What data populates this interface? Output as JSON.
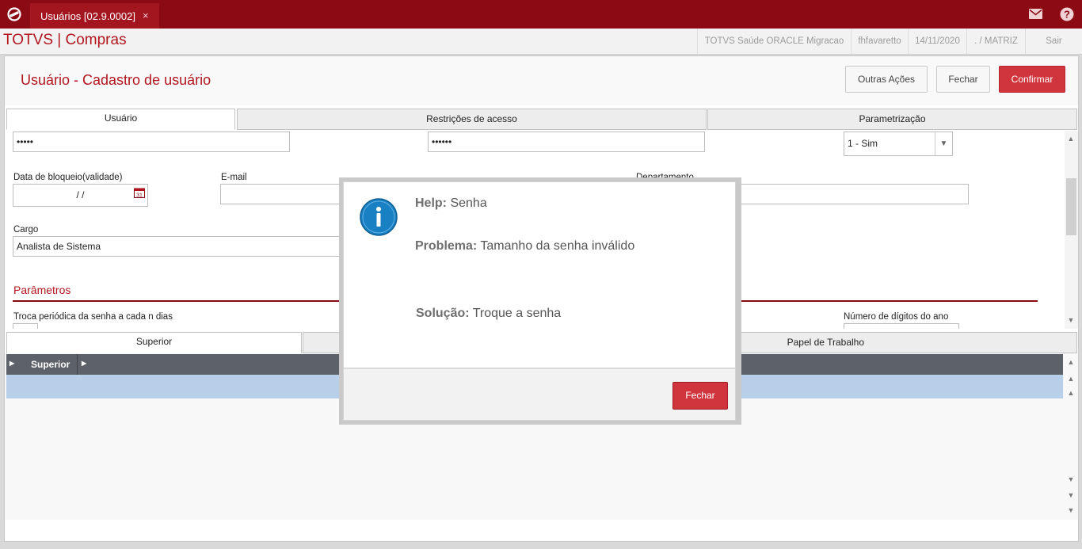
{
  "topbar": {
    "tab_label": "Usuários [02.9.0002]",
    "tab_close": "×"
  },
  "appbar": {
    "title": "TOTVS | Compras",
    "environment": "TOTVS Saúde ORACLE Migracao",
    "user": "fhfavaretto",
    "date": "14/11/2020",
    "branch": ". / MATRIZ",
    "logout": "Sair"
  },
  "page": {
    "title": "Usuário - Cadastro de usuário",
    "actions": {
      "other": "Outras Ações",
      "close": "Fechar",
      "confirm": "Confirmar"
    }
  },
  "tabs": [
    "Usuário",
    "Restrições de acesso",
    "Parametrização"
  ],
  "form": {
    "password": "•••••",
    "password_confirm": "••••••",
    "select_value": "1 - Sim",
    "block_date_label": "Data de bloqueio(validade)",
    "block_date_value": "/ /",
    "email_label": "E-mail",
    "department_label": "Departamento",
    "role_label": "Cargo",
    "role_value": "Analista de Sistema",
    "params_section": "Parâmetros",
    "periodic_label": "Troca periódica da senha a cada n dias",
    "year_digits_label": "Número de dígitos do ano"
  },
  "lower_tabs": [
    "Superior",
    "Papel de Trabalho"
  ],
  "grid": {
    "header": "Superior"
  },
  "dialog": {
    "help_label": "Help:",
    "help_value": "Senha",
    "problem_label": "Problema:",
    "problem_value": "Tamanho da senha inválido",
    "solution_label": "Solução:",
    "solution_value": "Troque a senha",
    "close": "Fechar"
  },
  "colors": {
    "brand": "#8b0a14",
    "accent": "#d0343d",
    "info_icon": "#1a80c4"
  }
}
